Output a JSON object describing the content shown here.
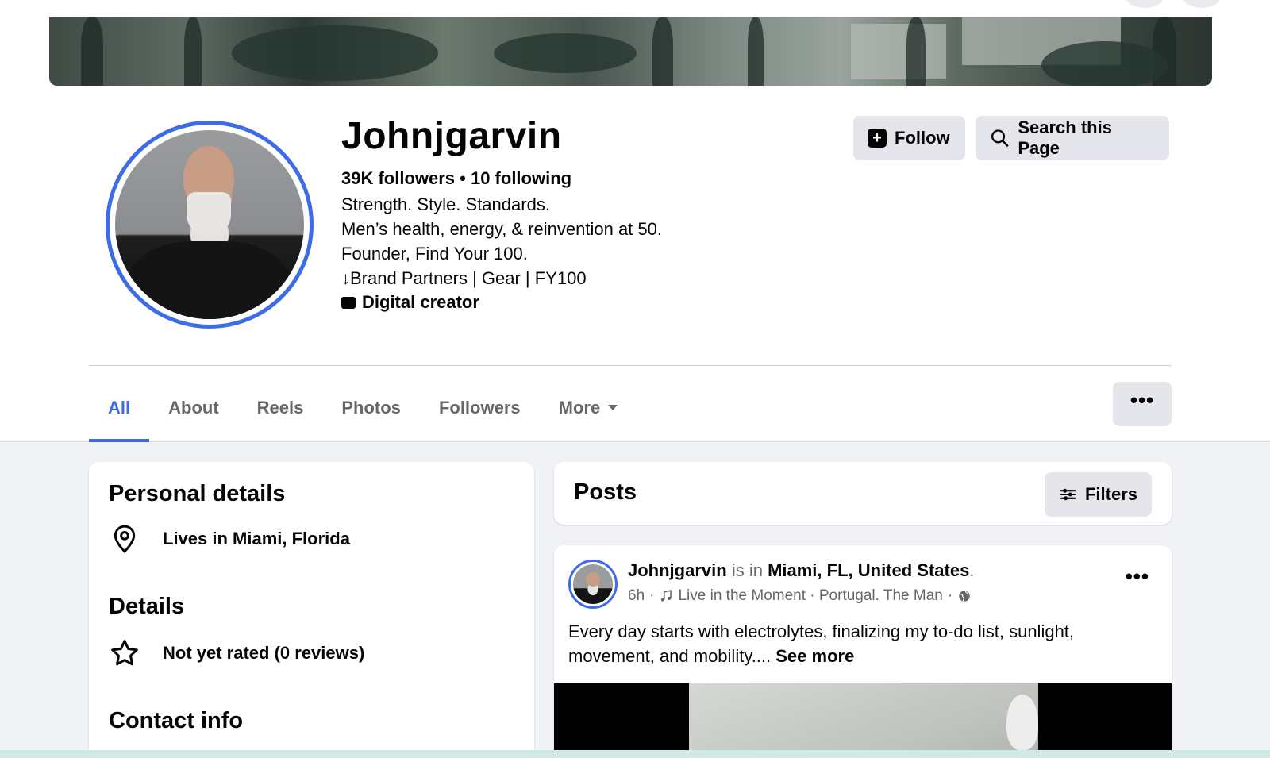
{
  "profile": {
    "name": "Johnjgarvin",
    "stats": "39K followers • 10 following",
    "bio_lines": [
      "Strength. Style. Standards.",
      "Men’s health, energy, & reinvention at 50.",
      "Founder, Find Your 100.",
      "↓Brand Partners | Gear | FY100"
    ],
    "category": "Digital creator"
  },
  "actions": {
    "follow_label": "Follow",
    "search_label": "Search this Page"
  },
  "tabs": [
    {
      "label": "All",
      "active": true
    },
    {
      "label": "About"
    },
    {
      "label": "Reels"
    },
    {
      "label": "Photos"
    },
    {
      "label": "Followers"
    },
    {
      "label": "More"
    }
  ],
  "more_menu_label": "•••",
  "intro": {
    "personal_details_title": "Personal details",
    "lives_in": "Lives in Miami, Florida",
    "details_title": "Details",
    "rating": "Not yet rated (0 reviews)",
    "contact_title": "Contact info"
  },
  "posts": {
    "title": "Posts",
    "filters_label": "Filters",
    "items": [
      {
        "author": "Johnjgarvin",
        "is_in": "is in",
        "location": "Miami, FL, United States",
        "period": ".",
        "time": "6h",
        "music": "Live in the Moment · Portugal. The Man",
        "text": "Every day starts with electrolytes, finalizing my to-do list, sunlight, movement, and mobility.... ",
        "see_more": "See more",
        "menu": "•••"
      }
    ]
  },
  "colors": {
    "accent": "#3d6ce7",
    "button_bg": "#e4e6eb",
    "page_bg": "#f0f2f5",
    "secondary_text": "#65676b"
  }
}
